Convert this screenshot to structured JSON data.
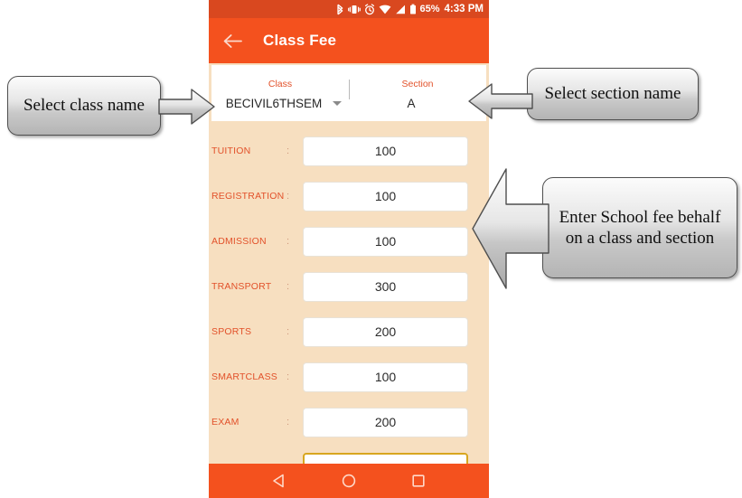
{
  "phone": {
    "status_bar": {
      "icons": [
        "bluetooth-icon",
        "vibrate-icon",
        "alarm-icon",
        "wifi-icon",
        "signal-icon",
        "battery-icon"
      ],
      "battery_percent": "65%",
      "time": "4:33 PM"
    },
    "app_bar": {
      "back_icon": "back-arrow-icon",
      "title": "Class Fee"
    },
    "selector": {
      "class": {
        "label": "Class",
        "value": "BECIVIL6THSEM"
      },
      "section": {
        "label": "Section",
        "value": "A"
      },
      "colon": ":"
    },
    "fees": {
      "colon": ":",
      "rows": [
        {
          "label": "TUITION",
          "value": "100",
          "focused": false
        },
        {
          "label": "REGISTRATION",
          "value": "100",
          "focused": false
        },
        {
          "label": "ADMISSION",
          "value": "100",
          "focused": false
        },
        {
          "label": "TRANSPORT",
          "value": "300",
          "focused": false
        },
        {
          "label": "SPORTS",
          "value": "200",
          "focused": false
        },
        {
          "label": "SMARTCLASS",
          "value": "100",
          "focused": false
        },
        {
          "label": "EXAM",
          "value": "200",
          "focused": false
        },
        {
          "label": "",
          "value": "",
          "focused": true
        }
      ]
    },
    "nav_bar": {
      "back": "nav-back-icon",
      "home": "nav-home-icon",
      "recents": "nav-recents-icon"
    }
  },
  "annotations": [
    {
      "text": "Select class name",
      "direction": "right"
    },
    {
      "text": "Select section name",
      "direction": "left"
    },
    {
      "text": "Enter School fee behalf on a class and section",
      "direction": "left"
    }
  ],
  "colors": {
    "status_bar": "#d9481f",
    "app_bar": "#f4511e",
    "page_background": "#f7dfc0",
    "label_orange": "#e2512a",
    "input_focus_border": "#d8a61f"
  }
}
